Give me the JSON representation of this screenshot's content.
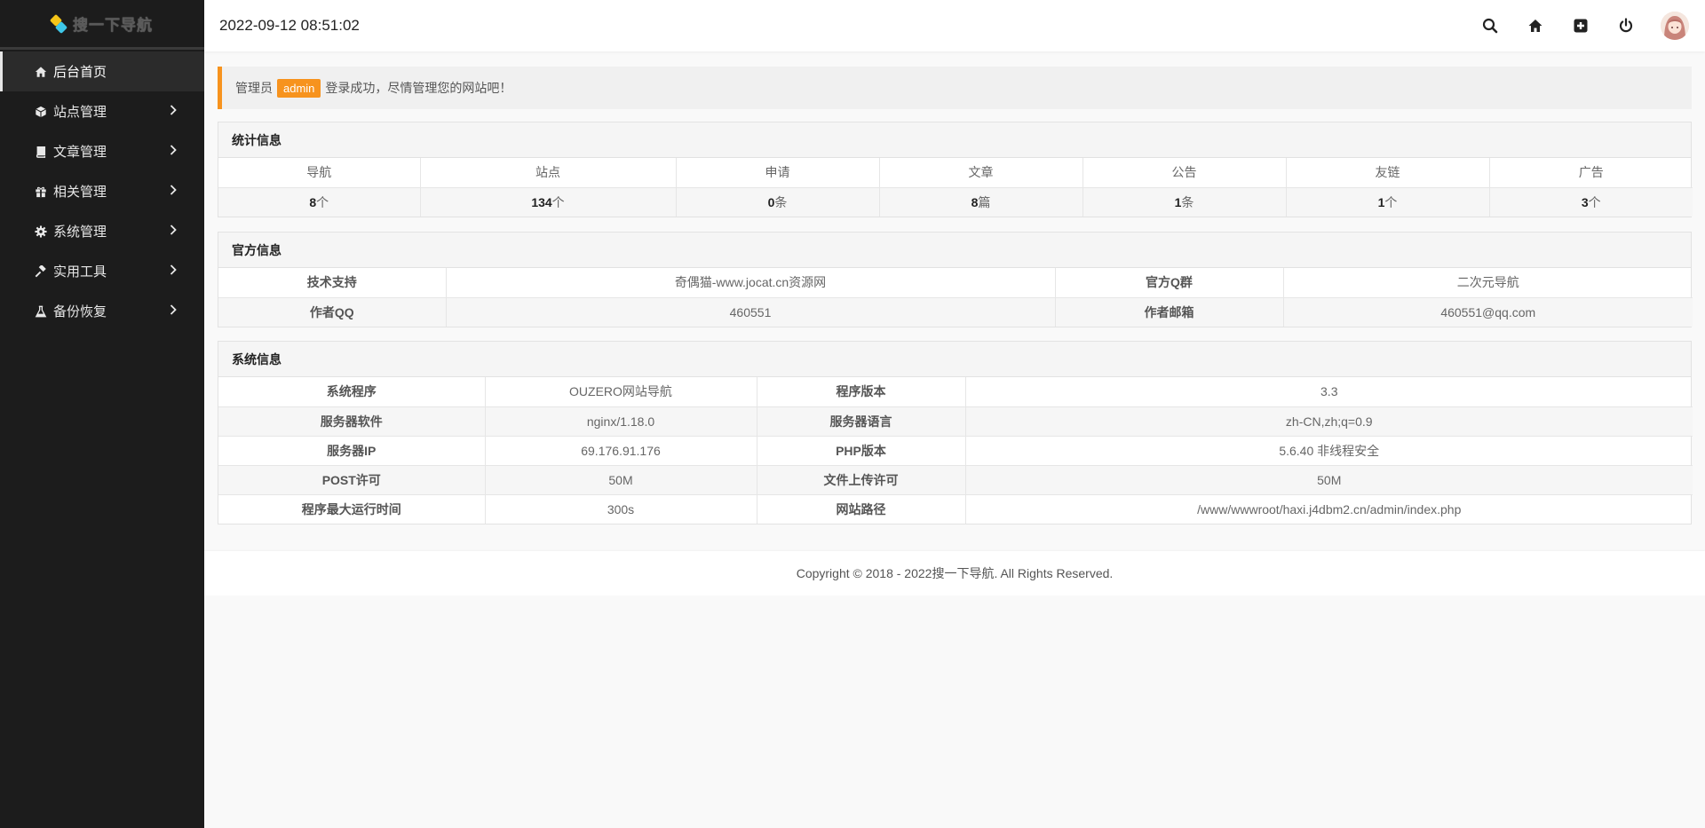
{
  "brand": {
    "name": "搜一下导航"
  },
  "sidebar": {
    "items": [
      {
        "label": "后台首页",
        "icon": "home-icon",
        "active": true
      },
      {
        "label": "站点管理",
        "icon": "cube-icon"
      },
      {
        "label": "文章管理",
        "icon": "book-icon"
      },
      {
        "label": "相关管理",
        "icon": "gift-icon"
      },
      {
        "label": "系统管理",
        "icon": "gear-icon"
      },
      {
        "label": "实用工具",
        "icon": "gavel-icon"
      },
      {
        "label": "备份恢复",
        "icon": "flask-icon"
      }
    ]
  },
  "header": {
    "datetime": "2022-09-12 08:51:02",
    "icons": [
      "search-icon",
      "home-icon",
      "plus-square-icon",
      "power-icon",
      "avatar"
    ]
  },
  "alert": {
    "prefix": "管理员",
    "username": "admin",
    "suffix": "登录成功，尽情管理您的网站吧！",
    "accent": "#f7931e"
  },
  "stats": {
    "title": "统计信息",
    "headers": [
      "导航",
      "站点",
      "申请",
      "文章",
      "公告",
      "友链",
      "广告"
    ],
    "values": [
      {
        "num": "8",
        "unit": "个"
      },
      {
        "num": "134",
        "unit": "个"
      },
      {
        "num": "0",
        "unit": "条"
      },
      {
        "num": "8",
        "unit": "篇"
      },
      {
        "num": "1",
        "unit": "条"
      },
      {
        "num": "1",
        "unit": "个"
      },
      {
        "num": "3",
        "unit": "个"
      }
    ]
  },
  "official": {
    "title": "官方信息",
    "rows": [
      [
        "技术支持",
        "奇偶猫-www.jocat.cn资源网",
        "官方Q群",
        "二次元导航"
      ],
      [
        "作者QQ",
        "460551",
        "作者邮箱",
        "460551@qq.com"
      ]
    ]
  },
  "system": {
    "title": "系统信息",
    "rows": [
      [
        "系统程序",
        "OUZERO网站导航",
        "程序版本",
        "3.3"
      ],
      [
        "服务器软件",
        "nginx/1.18.0",
        "服务器语言",
        "zh-CN,zh;q=0.9"
      ],
      [
        "服务器IP",
        "69.176.91.176",
        "PHP版本",
        "5.6.40 非线程安全"
      ],
      [
        "POST许可",
        "50M",
        "文件上传许可",
        "50M"
      ],
      [
        "程序最大运行时间",
        "300s",
        "网站路径",
        "/www/wwwroot/haxi.j4dbm2.cn/admin/index.php"
      ]
    ]
  },
  "footer": {
    "pre": "Copyright © 2018 - 2022 ",
    "site": "搜一下导航",
    "post": ". All Rights Reserved."
  }
}
